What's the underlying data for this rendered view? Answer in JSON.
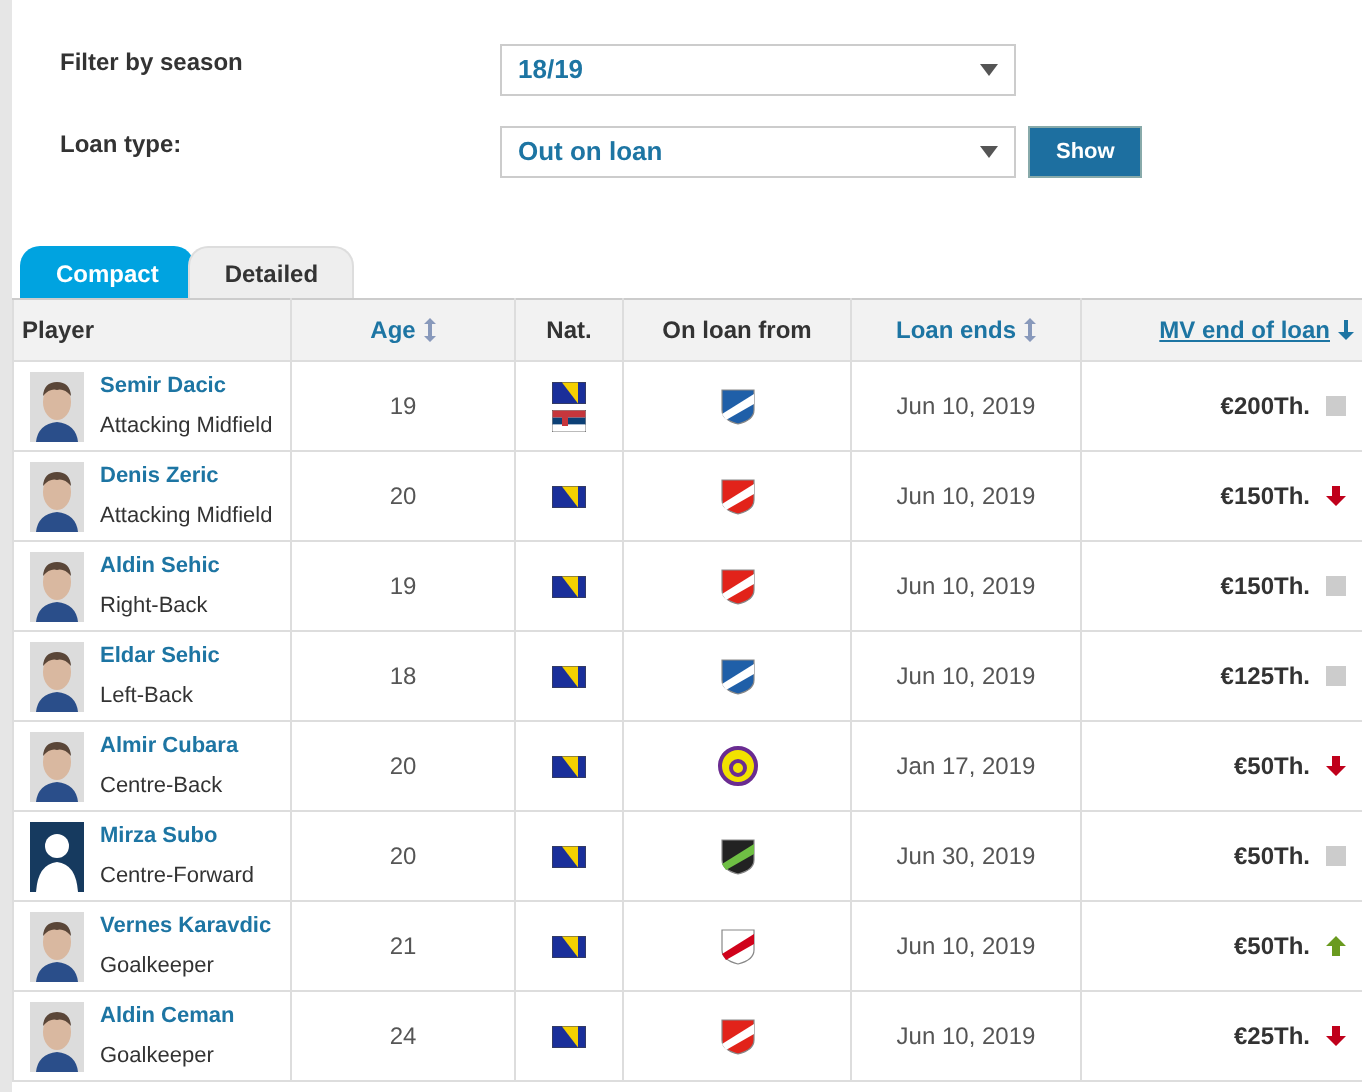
{
  "filters": [
    {
      "label": "Filter by season",
      "value": "18/19"
    },
    {
      "label": "Loan type:",
      "value": "Out on loan",
      "button": "Show"
    }
  ],
  "tabs": [
    {
      "label": "Compact",
      "selected": true
    },
    {
      "label": "Detailed",
      "selected": false
    }
  ],
  "table": {
    "columns": [
      {
        "label": "Player",
        "kind": "plain"
      },
      {
        "label": "Age",
        "kind": "sortable"
      },
      {
        "label": "Nat.",
        "kind": "plain"
      },
      {
        "label": "On loan from",
        "kind": "plain"
      },
      {
        "label": "Loan ends",
        "kind": "sortable"
      },
      {
        "label": "MV end of loan",
        "kind": "sorted"
      }
    ],
    "rows": [
      {
        "name": "Semir Dacic",
        "position": "Attacking Midfield",
        "avatar": {
          "kind": "photo"
        },
        "age": "19",
        "nat": [
          {
            "kind": "bih"
          },
          {
            "kind": "srb"
          }
        ],
        "crest": {
          "kind": "blue"
        },
        "loan_ends": "Jun 10, 2019",
        "mv": "€200Th.",
        "trend": {
          "kind": "none"
        }
      },
      {
        "name": "Denis Zeric",
        "position": "Attacking Midfield",
        "avatar": {
          "kind": "photo"
        },
        "age": "20",
        "nat": [
          {
            "kind": "bih"
          }
        ],
        "crest": {
          "kind": "red"
        },
        "loan_ends": "Jun 10, 2019",
        "mv": "€150Th.",
        "trend": {
          "kind": "down"
        }
      },
      {
        "name": "Aldin Sehic",
        "position": "Right-Back",
        "avatar": {
          "kind": "photo"
        },
        "age": "19",
        "nat": [
          {
            "kind": "bih"
          }
        ],
        "crest": {
          "kind": "red"
        },
        "loan_ends": "Jun 10, 2019",
        "mv": "€150Th.",
        "trend": {
          "kind": "none"
        }
      },
      {
        "name": "Eldar Sehic",
        "position": "Left-Back",
        "avatar": {
          "kind": "photo"
        },
        "age": "18",
        "nat": [
          {
            "kind": "bih"
          }
        ],
        "crest": {
          "kind": "blue"
        },
        "loan_ends": "Jun 10, 2019",
        "mv": "€125Th.",
        "trend": {
          "kind": "none"
        }
      },
      {
        "name": "Almir Cubara",
        "position": "Centre-Back",
        "avatar": {
          "kind": "photo"
        },
        "age": "20",
        "nat": [
          {
            "kind": "bih"
          }
        ],
        "crest": {
          "kind": "yellow"
        },
        "loan_ends": "Jan 17, 2019",
        "mv": "€50Th.",
        "trend": {
          "kind": "down"
        }
      },
      {
        "name": "Mirza Subo",
        "position": "Centre-Forward",
        "avatar": {
          "kind": "silhouette"
        },
        "age": "20",
        "nat": [
          {
            "kind": "bih"
          }
        ],
        "crest": {
          "kind": "green"
        },
        "loan_ends": "Jun 30, 2019",
        "mv": "€50Th.",
        "trend": {
          "kind": "none"
        }
      },
      {
        "name": "Vernes Karavdic",
        "position": "Goalkeeper",
        "avatar": {
          "kind": "photo"
        },
        "age": "21",
        "nat": [
          {
            "kind": "bih"
          }
        ],
        "crest": {
          "kind": "white"
        },
        "loan_ends": "Jun 10, 2019",
        "mv": "€50Th.",
        "trend": {
          "kind": "up"
        }
      },
      {
        "name": "Aldin Ceman",
        "position": "Goalkeeper",
        "avatar": {
          "kind": "photo"
        },
        "age": "24",
        "nat": [
          {
            "kind": "bih"
          }
        ],
        "crest": {
          "kind": "red"
        },
        "loan_ends": "Jun 10, 2019",
        "mv": "€25Th.",
        "trend": {
          "kind": "down"
        }
      }
    ]
  }
}
